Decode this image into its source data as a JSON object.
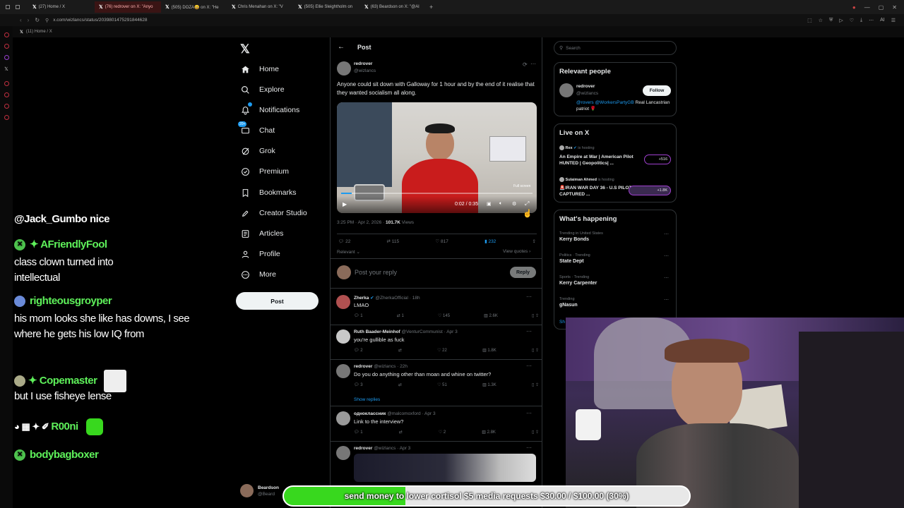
{
  "browser": {
    "tabs": [
      {
        "title": "(27) Home / X",
        "active": false
      },
      {
        "title": "(76) redrover on X: \"Anyo",
        "active": true
      },
      {
        "title": "(505) DOZA😀 on X: \"He",
        "active": false
      },
      {
        "title": "Chris Menahan on X: \"V",
        "active": false
      },
      {
        "title": "(505) Ellie Sleightholm on",
        "active": false
      },
      {
        "title": "(63) Beardson on X: \"@Al",
        "active": false
      }
    ],
    "url": "x.com/wizlancs/status/2039801475291844628",
    "bookmark": "(11) Home / X",
    "ai_label": "AI"
  },
  "nav": {
    "items": [
      {
        "label": "Home",
        "icon": "home-icon"
      },
      {
        "label": "Explore",
        "icon": "search-icon"
      },
      {
        "label": "Notifications",
        "icon": "bell-icon"
      },
      {
        "label": "Chat",
        "icon": "chat-icon"
      },
      {
        "label": "Grok",
        "icon": "grok-icon"
      },
      {
        "label": "Premium",
        "icon": "premium-icon"
      },
      {
        "label": "Bookmarks",
        "icon": "bookmark-icon"
      },
      {
        "label": "Creator Studio",
        "icon": "rocket-icon"
      },
      {
        "label": "Articles",
        "icon": "articles-icon"
      },
      {
        "label": "Profile",
        "icon": "person-icon"
      },
      {
        "label": "More",
        "icon": "more-circle-icon"
      }
    ],
    "chat_badge": "20+",
    "post_button": "Post"
  },
  "post": {
    "header_title": "Post",
    "author_name": "redrover",
    "author_handle": "@wizlancs",
    "text": "Anyone could sit down with Galloway for 1 hour and by the end of it realise that they wanted socialism all along.",
    "video_time": "0:02 / 0:35",
    "video_fullscreen_hint": "Full screen",
    "video_progress": 0.057,
    "meta_time": "3:25 PM · Apr 2, 2026 · ",
    "meta_views": "101.7K",
    "meta_views_label": " Views",
    "stats": {
      "replies": "22",
      "reposts": "115",
      "likes": "817",
      "bookmarks": "232"
    },
    "sort": "Relevant",
    "view_quotes": "View quotes",
    "reply_placeholder": "Post your reply",
    "reply_button": "Reply"
  },
  "replies": [
    {
      "name": "Zherka",
      "handle": "@ZherkaOfficial · 18h",
      "text": "LMAO",
      "stats": [
        "1",
        "1",
        "145",
        "2.6K"
      ]
    },
    {
      "name": "Ruth Baader-Meinhof",
      "handle": "@VenturCommunist · Apr 3",
      "text": "you're gullible as fuck",
      "stats": [
        "2",
        "",
        "22",
        "1.8K"
      ]
    },
    {
      "name": "redrover",
      "handle": "@wizlancs · 22h",
      "text": "Do you do anything other than moan and whine on twitter?",
      "stats": [
        "3",
        "",
        "51",
        "1.3K"
      ]
    },
    {
      "name": "одноклассник",
      "handle": "@malcomoxford · Apr 3",
      "text": "Link to the interview?",
      "stats": [
        "1",
        "",
        "2",
        "2.8K"
      ]
    },
    {
      "name": "redrover",
      "handle": "@wizlancs · Apr 3",
      "text": "",
      "stats": []
    }
  ],
  "show_replies": "Show replies",
  "right": {
    "search_placeholder": "Search",
    "relevant_title": "Relevant people",
    "relevant_name": "redrover",
    "relevant_handle": "@wizlancs",
    "relevant_bio_link": "@rovers @WorkersPartyGB",
    "relevant_bio": " Real Lancastrian patriot 🌹",
    "follow": "Follow",
    "live_title": "Live on X",
    "live": [
      {
        "host": "Rex",
        "hosting": " is hosting",
        "title": "An Empire at War | American Pilot HUNTED | Geopolitics| ...",
        "count": "+516"
      },
      {
        "host": "Sulaiman Ahmed",
        "hosting": " is hosting",
        "title": "🚨IRAN WAR DAY 36 - U.S PILOT CAPTURED ...",
        "count": "+1.8K"
      }
    ],
    "happening_title": "What's happening",
    "trends": [
      {
        "context": "Trending in United States",
        "name": "Kerry Bonds"
      },
      {
        "context": "Politics · Trending",
        "name": "State Dept"
      },
      {
        "context": "Sports · Trending",
        "name": "Kerry Carpenter"
      },
      {
        "context": "Trending",
        "name": "gNasun"
      }
    ],
    "show_more": "Sh"
  },
  "chat": [
    {
      "user": "@Jack_Gumbo nice",
      "text": ""
    },
    {
      "user": "AFriendlyFool",
      "text": "class clown turned into intellectual"
    },
    {
      "user": "righteousgroyper",
      "text": "his mom looks she like has downs, I see where he gets his low IQ from"
    },
    {
      "user": "Copemaster",
      "text": "but I use fisheye lense"
    },
    {
      "user": "R00ni",
      "text": ""
    },
    {
      "user": "bodybagboxer",
      "text": ""
    }
  ],
  "bottom_account": {
    "name": "Beardson",
    "handle": "@Beard"
  },
  "donation": {
    "text_highlight": "send money to",
    "text_rest": " lower cortisol $5 media requests $30.00 / $100.00 (30%)",
    "progress": 0.3
  },
  "colors": {
    "accent": "#1d9bf0",
    "chat_user": "#5ef05a",
    "donation_fill": "#38d81e",
    "active_tab": "#3a1414"
  }
}
